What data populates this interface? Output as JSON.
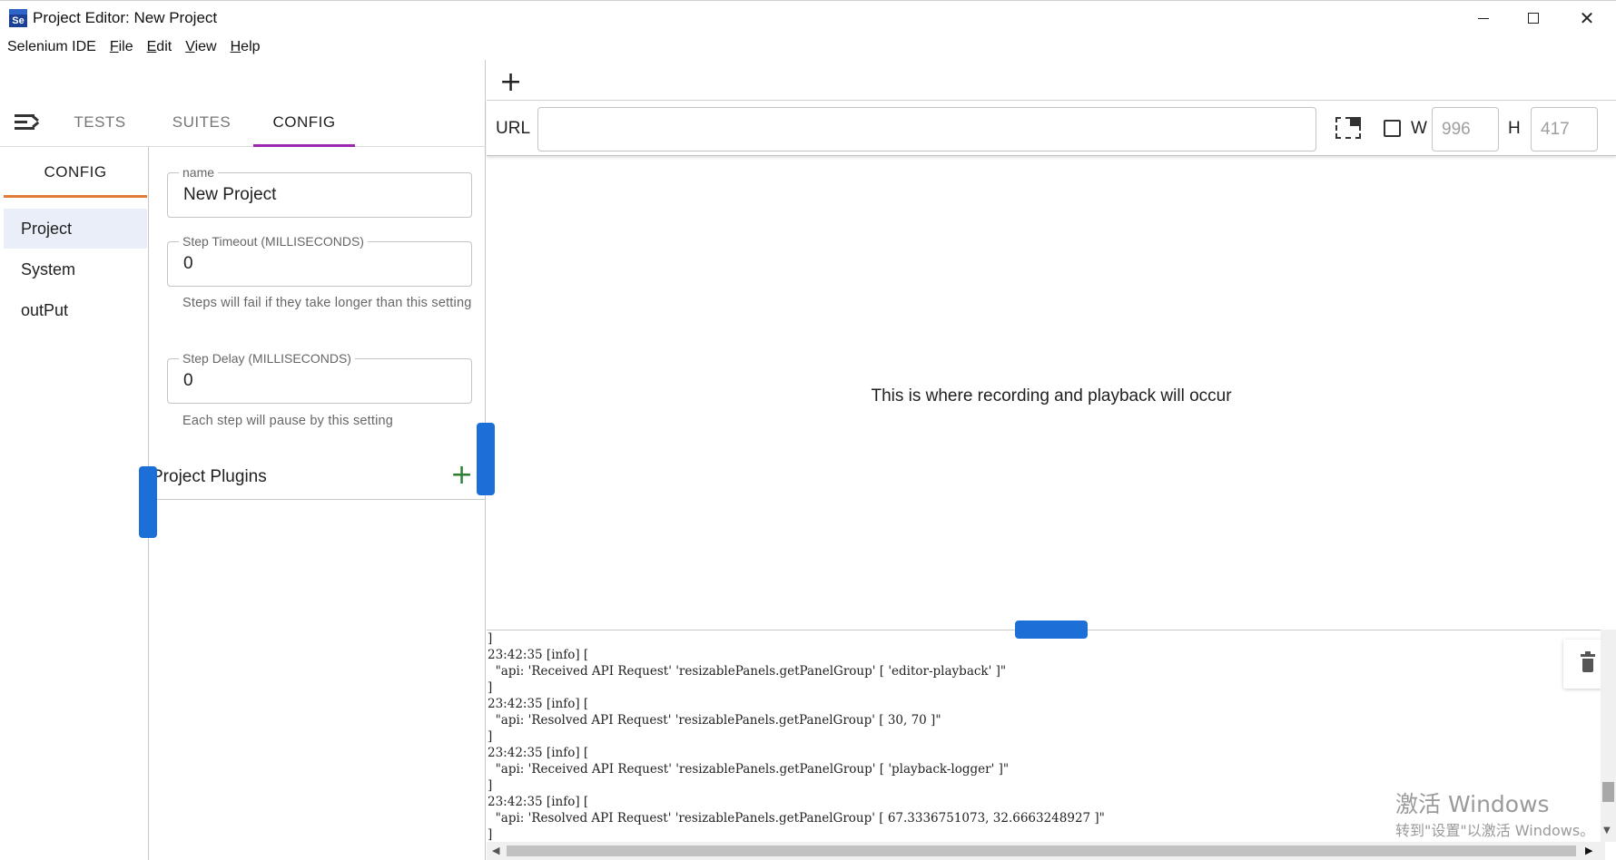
{
  "window": {
    "app_icon_text": "Se",
    "title": "Project Editor: New Project"
  },
  "menubar": {
    "items": [
      {
        "label": "Selenium IDE"
      },
      {
        "mnemonic": "F",
        "rest": "ile"
      },
      {
        "mnemonic": "E",
        "rest": "dit"
      },
      {
        "mnemonic": "V",
        "rest": "iew"
      },
      {
        "mnemonic": "H",
        "rest": "elp"
      }
    ]
  },
  "tabs": {
    "tests": "TESTS",
    "suites": "SUITES",
    "config": "CONFIG",
    "active": "CONFIG",
    "active_color": "#9c27b0"
  },
  "config_nav": {
    "header": "CONFIG",
    "header_underline_color": "#e07b39",
    "items": [
      "Project",
      "System",
      "outPut"
    ],
    "active": "Project"
  },
  "config_form": {
    "name": {
      "label": "name",
      "value": "New Project"
    },
    "step_timeout": {
      "label": "Step Timeout (MILLISECONDS)",
      "value": "0",
      "helper": "Steps will fail if they take longer than this setting"
    },
    "step_delay": {
      "label": "Step Delay (MILLISECONDS)",
      "value": "0",
      "helper": "Each step will pause by this setting"
    },
    "plugins_title": "Project Plugins",
    "plugins_add_icon": "plus-icon"
  },
  "playback": {
    "add_tab_icon": "plus-icon",
    "url_label": "URL",
    "url_value": "",
    "width_label": "W",
    "width_placeholder": "996",
    "height_label": "H",
    "height_placeholder": "417",
    "message": "This is where recording and playback will occur"
  },
  "logger": {
    "lines": [
      "]",
      "23:42:35 [info] [",
      "  \"api: 'Received API Request' 'resizablePanels.getPanelGroup' [ 'editor-playback' ]\"",
      "]",
      "23:42:35 [info] [",
      "  \"api: 'Resolved API Request' 'resizablePanels.getPanelGroup' [ 30, 70 ]\"",
      "]",
      "23:42:35 [info] [",
      "  \"api: 'Received API Request' 'resizablePanels.getPanelGroup' [ 'playback-logger' ]\"",
      "]",
      "23:42:35 [info] [",
      "  \"api: 'Resolved API Request' 'resizablePanels.getPanelGroup' [ 67.3336751073, 32.6663248927 ]\"",
      "]"
    ],
    "clear_icon": "trash-icon"
  },
  "watermark": {
    "line1": "激活 Windows",
    "line2": "转到\"设置\"以激活 Windows。"
  },
  "colors": {
    "handle": "#1c6fd6",
    "plugin_add": "#2e7d32",
    "nav_active_bg": "#e9eef8"
  }
}
